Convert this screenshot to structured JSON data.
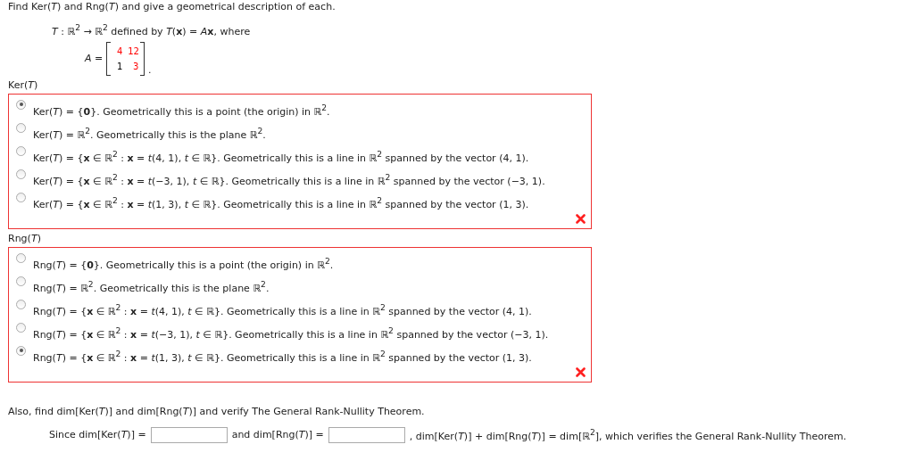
{
  "prompt": "Find Ker(*T*) and Rng(*T*) and give a geometrical description of each.",
  "definition": [
    "*T* : ℝ$^{2}$ → ℝ$^{2}$ defined by *T*(**x**) = *A*",
    "**x**,  where"
  ],
  "matrix": {
    "label": "*A* =",
    "suffix": ".",
    "rows": [
      [
        {
          "value": "4",
          "color": "#ff0000"
        },
        {
          "value": "12",
          "color": "#ff0000"
        }
      ],
      [
        {
          "value": "1",
          "color": "#000000"
        },
        {
          "value": "3",
          "color": "#ff0000"
        }
      ]
    ]
  },
  "questions": [
    {
      "label": "Ker(*T*)",
      "correct": false,
      "options": [
        {
          "text": "Ker(*T*) = {**0**}. Geometrically this is a point (the origin) in ℝ$^{2}$.",
          "selected": true
        },
        {
          "text": "Ker(*T*) = ℝ$^{2}$. Geometrically this is the plane ℝ$^{2}$.",
          "selected": false
        },
        {
          "text": "Ker(*T*) = {**x** ∈ ℝ$^{2}$ : **x** = *t*(4, 1), *t* ∈ ℝ}. Geometrically this is a line in ℝ$^{2}$ spanned by the vector (4, 1).",
          "selected": false
        },
        {
          "text": "Ker(*T*) = {**x** ∈ ℝ$^{2}$ : **x** = *t*(−3, 1), *t* ∈ ℝ}. Geometrically this is a line in ℝ$^{2}$ spanned by the vector (−3, 1).",
          "selected": false
        },
        {
          "text": "Ker(*T*) = {**x** ∈ ℝ$^{2}$ : **x** = *t*(1, 3), *t* ∈ ℝ}. Geometrically this is a line in ℝ$^{2}$ spanned by the vector (1, 3).",
          "selected": false
        }
      ]
    },
    {
      "label": "Rng(*T*)",
      "correct": false,
      "options": [
        {
          "text": "Rng(*T*) = {**0**}. Geometrically this is a point (the origin) in ℝ$^{2}$.",
          "selected": false
        },
        {
          "text": "Rng(*T*) = ℝ$^{2}$. Geometrically this is the plane ℝ$^{2}$.",
          "selected": false
        },
        {
          "text": "Rng(*T*) = {**x** ∈ ℝ$^{2}$ : **x** = *t*(4, 1), *t* ∈ ℝ}. Geometrically this is a line in ℝ$^{2}$ spanned by the vector (4, 1).",
          "selected": false
        },
        {
          "text": "Rng(*T*) = {**x** ∈ ℝ$^{2}$ : **x** = *t*(−3, 1), *t* ∈ ℝ}. Geometrically this is a line in ℝ$^{2}$ spanned by the vector (−3, 1).",
          "selected": false
        },
        {
          "text": "Rng(*T*) = {**x** ∈ ℝ$^{2}$ : **x** = *t*(1, 3), *t* ∈ ℝ}. Geometrically this is a line in ℝ$^{2}$ spanned by the vector (1, 3).",
          "selected": true
        }
      ]
    }
  ],
  "followup": "Also, find dim[Ker(*T*)] and dim[Rng(*T*)] and verify The General Rank-Nullity Theorem.",
  "answer_line": [
    {
      "kind": "text",
      "text": "Since dim[Ker(*T*)] ="
    },
    {
      "kind": "field"
    },
    {
      "kind": "text",
      "text": "and dim[Rng(*T*)] ="
    },
    {
      "kind": "field"
    },
    {
      "kind": "text",
      "text": ", dim[Ker(*T*)] + dim[Rng(*T*)] = dim[ℝ$^{2}$], which verifies the General Rank-Nullity Theorem."
    }
  ]
}
